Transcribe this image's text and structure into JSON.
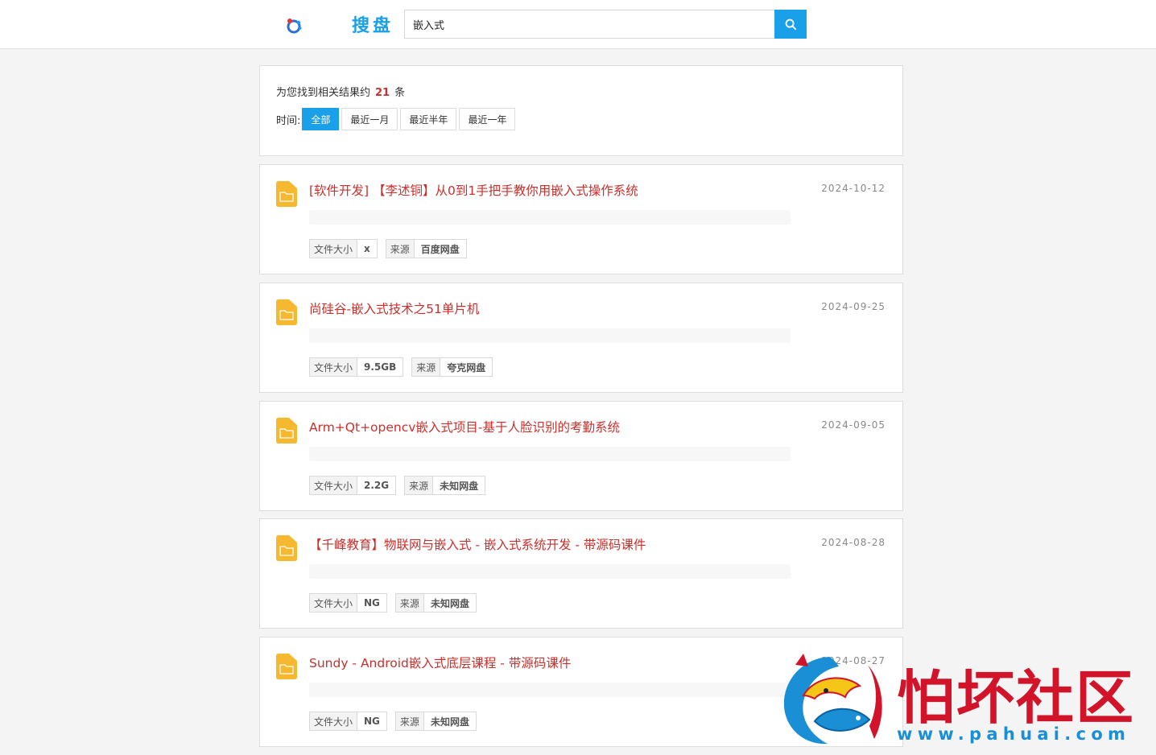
{
  "header": {
    "brand": "搜盘",
    "search_value": "嵌入式",
    "search_icon": "search-icon",
    "logo_icon": "baidu-paw-logo-icon"
  },
  "filter": {
    "count_prefix": "为您找到相关结果约",
    "count": "21",
    "count_suffix": "条",
    "time_label": "时间:",
    "options": [
      "全部",
      "最近一月",
      "最近半年",
      "最近一年"
    ],
    "active_option": "全部"
  },
  "labels": {
    "size": "文件大小",
    "source": "来源"
  },
  "results": [
    {
      "title": "[软件开发] 【李述铜】从0到1手把手教你用嵌入式操作系统",
      "date": "2024-10-12",
      "size": "x",
      "source": "百度网盘"
    },
    {
      "title": "尚硅谷-嵌入式技术之51单片机",
      "date": "2024-09-25",
      "size": "9.5GB",
      "source": "夸克网盘"
    },
    {
      "title": "Arm+Qt+opencv嵌入式项目-基于人脸识别的考勤系统",
      "date": "2024-09-05",
      "size": "2.2G",
      "source": "未知网盘"
    },
    {
      "title": "【千峰教育】物联网与嵌入式 - 嵌入式系统开发 - 带源码课件",
      "date": "2024-08-28",
      "size": "NG",
      "source": "未知网盘"
    },
    {
      "title": "Sundy - Android嵌入式底层课程 - 带源码课件",
      "date": "2024-08-27",
      "size": "NG",
      "source": "未知网盘"
    }
  ],
  "watermark": {
    "text": "怕坏社区",
    "url": "www.pahuai.com"
  },
  "colors": {
    "accent": "#1aa0e8",
    "title_red": "#c9302c",
    "folder_yellow": "#f5b82e",
    "watermark_red": "#d2142a",
    "watermark_blue": "#1a8fd6"
  }
}
